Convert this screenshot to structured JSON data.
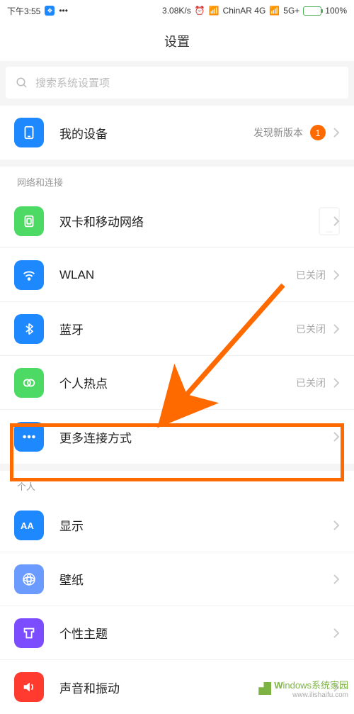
{
  "status": {
    "time": "下午3:55",
    "speed": "3.08K/s",
    "carrier": "ChinAR 4G",
    "net5g": "5G+",
    "battery": "100%"
  },
  "header": {
    "title": "设置"
  },
  "search": {
    "placeholder": "搜索系统设置项"
  },
  "top": {
    "device": "我的设备",
    "device_hint": "发现新版本",
    "device_badge": "1"
  },
  "network": {
    "header": "网络和连接",
    "sim": "双卡和移动网络",
    "wlan": "WLAN",
    "wlan_status": "已关闭",
    "bt": "蓝牙",
    "bt_status": "已关闭",
    "hotspot": "个人热点",
    "hotspot_status": "已关闭",
    "more": "更多连接方式"
  },
  "personal": {
    "header": "个人",
    "display": "显示",
    "wallpaper": "壁纸",
    "theme": "个性主题",
    "sound": "声音和振动"
  },
  "watermark": {
    "text": "indows系统家园",
    "domain": "www.ilishaifu.com"
  }
}
